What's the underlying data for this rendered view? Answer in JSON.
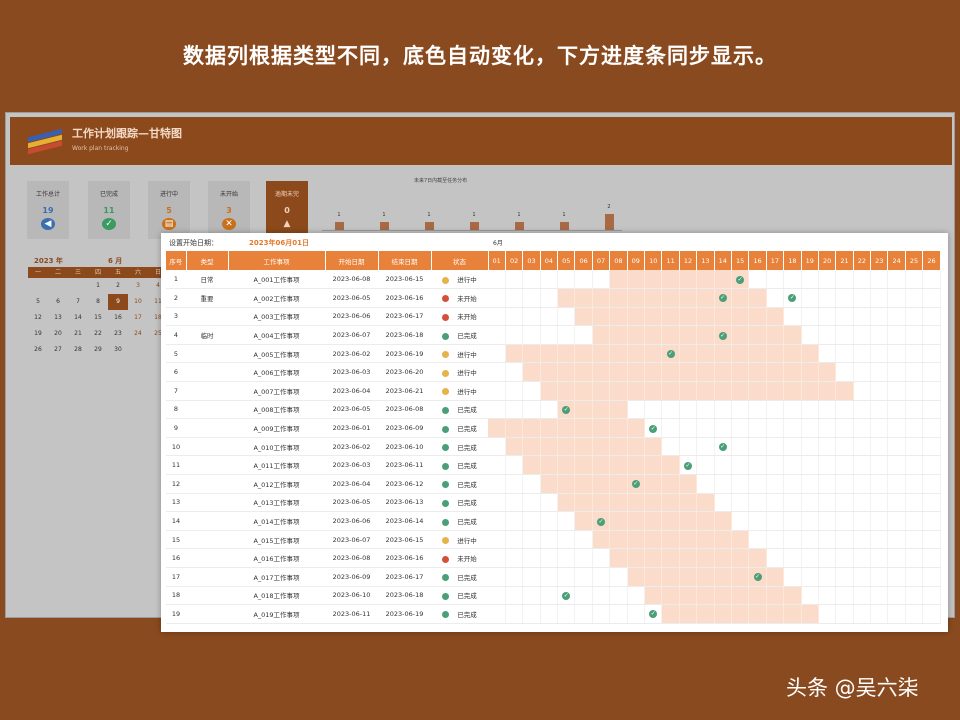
{
  "headline": "数据列根据类型不同，底色自动变化，下方进度条同步显示。",
  "dashboard": {
    "title": "工作计划跟踪—甘特图",
    "subtitle": "Work plan tracking",
    "kpis": [
      {
        "label": "工作总计",
        "value": "19",
        "color": "#3a6fb0",
        "icon": "speaker-icon"
      },
      {
        "label": "已完成",
        "value": "11",
        "color": "#3a9a60",
        "icon": "check-circle-icon"
      },
      {
        "label": "进行中",
        "value": "5",
        "color": "#c8701c",
        "icon": "progress-icon"
      },
      {
        "label": "未开始",
        "value": "3",
        "color": "#c8701c",
        "icon": "x-circle-icon"
      },
      {
        "label": "逾期未完",
        "value": "0",
        "color": "#f2d2ba",
        "icon": "warning-icon"
      }
    ],
    "mini_chart": {
      "title": "未来7日内截至任务分布",
      "values": [
        1,
        1,
        1,
        1,
        1,
        1,
        2
      ]
    },
    "calendar": {
      "year_label": "2023 年",
      "month_label": "6 月",
      "weekdays": [
        "一",
        "二",
        "三",
        "四",
        "五",
        "六",
        "日"
      ],
      "rows": [
        [
          "",
          "",
          "",
          "1",
          "2",
          "3",
          "4"
        ],
        [
          "5",
          "6",
          "7",
          "8",
          "9",
          "10",
          "11"
        ],
        [
          "12",
          "13",
          "14",
          "15",
          "16",
          "17",
          "18"
        ],
        [
          "19",
          "20",
          "21",
          "22",
          "23",
          "24",
          "25"
        ],
        [
          "26",
          "27",
          "28",
          "29",
          "30",
          "",
          ""
        ]
      ],
      "today": "9"
    }
  },
  "gantt": {
    "setting_label": "设置开始日期：",
    "start_date": "2023年06月01日",
    "month_label": "6月",
    "headers": [
      "序号",
      "类型",
      "工作事项",
      "开始日期",
      "结束日期",
      "状态"
    ],
    "days": [
      "01",
      "02",
      "03",
      "04",
      "05",
      "06",
      "07",
      "08",
      "09",
      "10",
      "11",
      "12",
      "13",
      "14",
      "15",
      "16",
      "17",
      "18",
      "19",
      "20",
      "21",
      "22",
      "23",
      "24",
      "25",
      "26"
    ],
    "rows": [
      {
        "no": "1",
        "type": "日常",
        "item": "A_001工作事项",
        "start": "2023-06-08",
        "end": "2023-06-15",
        "status": "进行中",
        "s": 8,
        "e": 15,
        "m": 15
      },
      {
        "no": "2",
        "type": "重要",
        "item": "A_002工作事项",
        "start": "2023-06-05",
        "end": "2023-06-16",
        "status": "未开始",
        "s": 5,
        "e": 16,
        "m": 14,
        "m2": 18
      },
      {
        "no": "3",
        "type": "",
        "item": "A_003工作事项",
        "start": "2023-06-06",
        "end": "2023-06-17",
        "status": "未开始",
        "s": 6,
        "e": 17
      },
      {
        "no": "4",
        "type": "临时",
        "item": "A_004工作事项",
        "start": "2023-06-07",
        "end": "2023-06-18",
        "status": "已完成",
        "s": 7,
        "e": 18,
        "m": 14
      },
      {
        "no": "5",
        "type": "",
        "item": "A_005工作事项",
        "start": "2023-06-02",
        "end": "2023-06-19",
        "status": "进行中",
        "s": 2,
        "e": 19,
        "m": 11
      },
      {
        "no": "6",
        "type": "",
        "item": "A_006工作事项",
        "start": "2023-06-03",
        "end": "2023-06-20",
        "status": "进行中",
        "s": 3,
        "e": 20
      },
      {
        "no": "7",
        "type": "",
        "item": "A_007工作事项",
        "start": "2023-06-04",
        "end": "2023-06-21",
        "status": "进行中",
        "s": 4,
        "e": 21
      },
      {
        "no": "8",
        "type": "",
        "item": "A_008工作事项",
        "start": "2023-06-05",
        "end": "2023-06-08",
        "status": "已完成",
        "s": 5,
        "e": 8,
        "m": 5
      },
      {
        "no": "9",
        "type": "",
        "item": "A_009工作事项",
        "start": "2023-06-01",
        "end": "2023-06-09",
        "status": "已完成",
        "s": 1,
        "e": 9,
        "m": 10
      },
      {
        "no": "10",
        "type": "",
        "item": "A_010工作事项",
        "start": "2023-06-02",
        "end": "2023-06-10",
        "status": "已完成",
        "s": 2,
        "e": 10,
        "m": 14
      },
      {
        "no": "11",
        "type": "",
        "item": "A_011工作事项",
        "start": "2023-06-03",
        "end": "2023-06-11",
        "status": "已完成",
        "s": 3,
        "e": 11,
        "m": 12
      },
      {
        "no": "12",
        "type": "",
        "item": "A_012工作事项",
        "start": "2023-06-04",
        "end": "2023-06-12",
        "status": "已完成",
        "s": 4,
        "e": 12,
        "m": 9
      },
      {
        "no": "13",
        "type": "",
        "item": "A_013工作事项",
        "start": "2023-06-05",
        "end": "2023-06-13",
        "status": "已完成",
        "s": 5,
        "e": 13
      },
      {
        "no": "14",
        "type": "",
        "item": "A_014工作事项",
        "start": "2023-06-06",
        "end": "2023-06-14",
        "status": "已完成",
        "s": 6,
        "e": 14,
        "m": 7
      },
      {
        "no": "15",
        "type": "",
        "item": "A_015工作事项",
        "start": "2023-06-07",
        "end": "2023-06-15",
        "status": "进行中",
        "s": 7,
        "e": 15
      },
      {
        "no": "16",
        "type": "",
        "item": "A_016工作事项",
        "start": "2023-06-08",
        "end": "2023-06-16",
        "status": "未开始",
        "s": 8,
        "e": 16
      },
      {
        "no": "17",
        "type": "",
        "item": "A_017工作事项",
        "start": "2023-06-09",
        "end": "2023-06-17",
        "status": "已完成",
        "s": 9,
        "e": 17,
        "m": 16
      },
      {
        "no": "18",
        "type": "",
        "item": "A_018工作事项",
        "start": "2023-06-10",
        "end": "2023-06-18",
        "status": "已完成",
        "s": 10,
        "e": 18,
        "m": 5
      },
      {
        "no": "19",
        "type": "",
        "item": "A_019工作事项",
        "start": "2023-06-11",
        "end": "2023-06-19",
        "status": "已完成",
        "s": 11,
        "e": 19,
        "m": 10
      }
    ]
  },
  "watermark": "头条 @吴六柒"
}
